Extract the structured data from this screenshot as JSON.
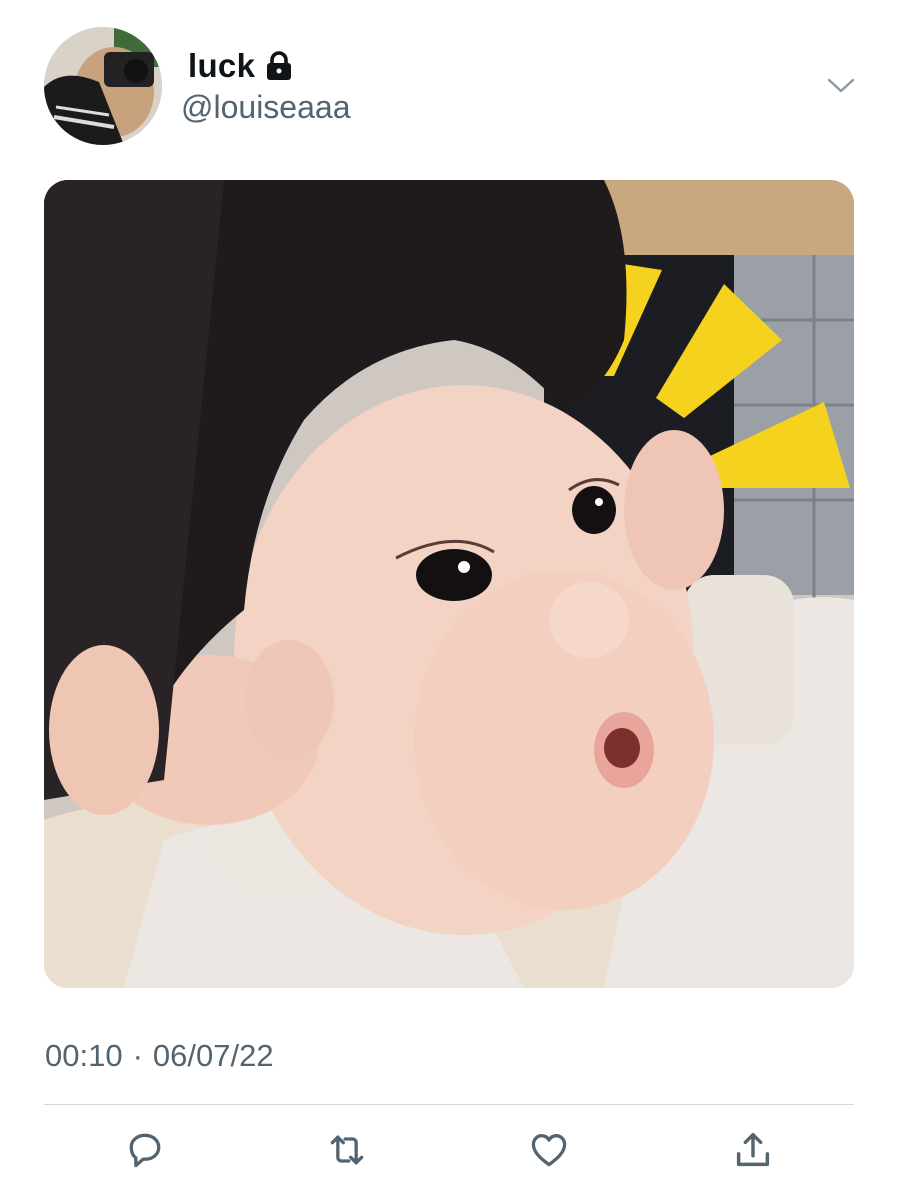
{
  "user": {
    "display_name": "luck",
    "handle": "@louiseaaa",
    "protected_icon": "lock-icon",
    "avatar": "profile-photo"
  },
  "tweet": {
    "media": "photo-baby-hands-on-cheeks",
    "time": "00:10",
    "separator": "·",
    "date": "06/07/22"
  },
  "actions": [
    {
      "icon": "reply-icon"
    },
    {
      "icon": "retweet-icon"
    },
    {
      "icon": "like-icon"
    },
    {
      "icon": "share-icon"
    }
  ],
  "colors": {
    "text_primary": "#0f1419",
    "text_secondary": "#536471",
    "divider": "#cfd9de",
    "accent_yellow": "#f5d21e"
  }
}
